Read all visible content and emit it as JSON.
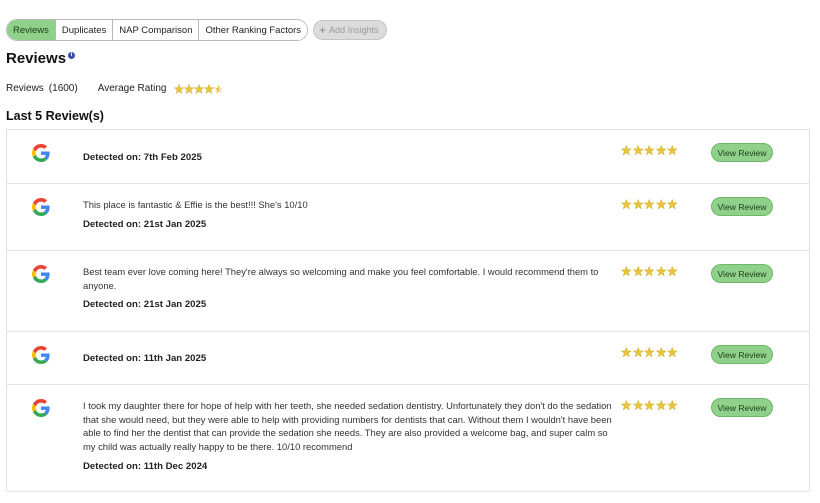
{
  "tabs": [
    {
      "label": "Reviews",
      "active": true
    },
    {
      "label": "Duplicates",
      "active": false
    },
    {
      "label": "NAP Comparison",
      "active": false
    },
    {
      "label": "Other Ranking Factors",
      "active": false
    }
  ],
  "add_insights_label": "Add Insights",
  "section_title": "Reviews",
  "summary": {
    "reviews_label": "Reviews",
    "reviews_count": "(1600)",
    "average_label": "Average Rating",
    "average_stars": 4.5
  },
  "last_title": "Last 5 Review(s)",
  "view_label": "View Review",
  "colors": {
    "accent": "#8fd18a",
    "star": "#e8c53a"
  },
  "reviews": [
    {
      "source_icon": "google-icon",
      "text": "",
      "detected": "Detected on: 7th Feb 2025",
      "stars": 5
    },
    {
      "source_icon": "google-icon",
      "text": "This place is fantastic & Effie is the best!!! She's 10/10",
      "detected": "Detected on: 21st Jan 2025",
      "stars": 5
    },
    {
      "source_icon": "google-icon",
      "text": "Best team ever love coming here! They're always so welcoming and make you feel comfortable. I would recommend them to anyone.",
      "detected": "Detected on: 21st Jan 2025",
      "stars": 5
    },
    {
      "source_icon": "google-icon",
      "text": "",
      "detected": "Detected on: 11th Jan 2025",
      "stars": 5
    },
    {
      "source_icon": "google-icon",
      "text": "I took my daughter there for hope of help with her teeth, she needed sedation dentistry. Unfortunately they don't do the sedation that she would need, but they were able to help with providing numbers for dentists that can. Without them I wouldn't have been able to find her the dentist that can provide the sedation she needs. They are also provided a welcome bag, and super calm so my child was actually really happy to be there. 10/10 recommend",
      "detected": "Detected on: 11th Dec 2024",
      "stars": 5
    }
  ]
}
